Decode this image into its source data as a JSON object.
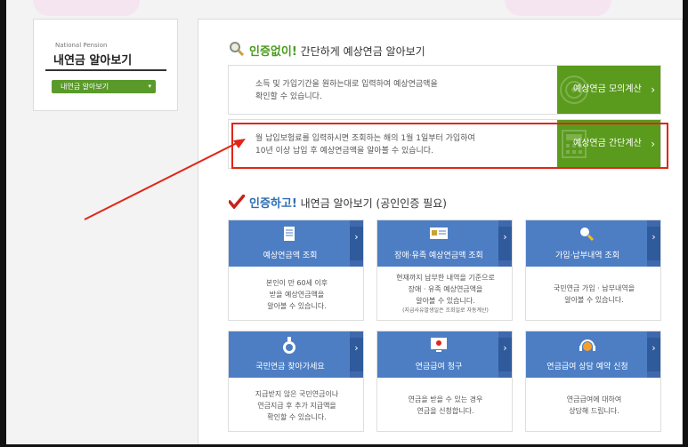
{
  "sidebar": {
    "subtitle": "National Pension",
    "title": "내연금 알아보기",
    "select_value": "내연금 알아보기"
  },
  "section1": {
    "highlight": "인증없이!",
    "rest": "간단하게 예상연금 알아보기",
    "rows": [
      {
        "line1": "소득 및 가입기간을 원하는대로 입력하여 예상연금액을",
        "line2": "확인할 수 있습니다.",
        "button": "예상연금 모의계산"
      },
      {
        "line1": "월 납입보험료를 입력하시면 조회하는 해의 1월 1일부터 가입하여",
        "line2": "10년 이상 납입 후 예상연금액을 알아볼 수 있습니다.",
        "button": "예상연금 간단계산"
      }
    ]
  },
  "section2": {
    "highlight": "인증하고!",
    "rest": "내연금 알아보기 (공인인증 필요)",
    "cards": [
      {
        "title": "예상연금액 조회",
        "lines": [
          "본인이 만 60세 이후",
          "받을 예상연금액을",
          "알아볼 수 있습니다."
        ],
        "note": ""
      },
      {
        "title": "장애·유족 예상연금액 조회",
        "lines": [
          "현재까지 납부한 내역을 기준으로",
          "장애 · 유족 예상연금액을",
          "알아볼 수 있습니다."
        ],
        "note": "(지급사유발생일은 조회일로 자동계산)"
      },
      {
        "title": "가입·납부내역 조회",
        "lines": [
          "국민연금 가입 · 납부내역을",
          "알아볼 수 있습니다."
        ],
        "note": ""
      },
      {
        "title": "국민연금 찾아가세요",
        "lines": [
          "지급받지 않은 국민연금이나",
          "연금지급 후 추가 지급액을",
          "확인할 수 있습니다."
        ],
        "note": ""
      },
      {
        "title": "연금급여 청구",
        "lines": [
          "연금을 받을 수 있는 경우",
          "연금을 신청합니다."
        ],
        "note": ""
      },
      {
        "title": "연금급여 상담 예약 신청",
        "lines": [
          "연금급여에 대하여",
          "상담해 드립니다."
        ],
        "note": ""
      }
    ]
  },
  "colors": {
    "green": "#5a9a1c",
    "blue": "#4d7ec4",
    "annotation_red": "#e0261a"
  },
  "icons": [
    "magnifier-icon",
    "checkmark-icon",
    "target-icon",
    "calculator-icon",
    "document-icon",
    "id-card-icon",
    "search-icon",
    "flask-icon",
    "monitor-icon",
    "headset-icon"
  ]
}
